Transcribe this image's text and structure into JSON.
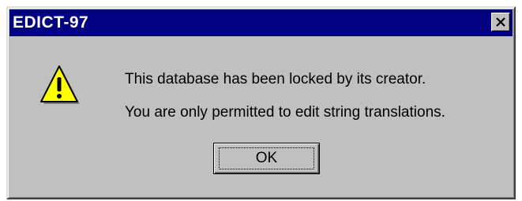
{
  "dialog": {
    "title": "EDICT-97",
    "close_icon": "close-icon",
    "icon": "warning-icon",
    "message_line1": "This database has been locked by its creator.",
    "message_line2": "You are only permitted to edit string translations.",
    "ok_label": "OK"
  },
  "colors": {
    "titlebar": "#000080",
    "face": "#c0c0c0",
    "warning_fill": "#ffff00"
  }
}
